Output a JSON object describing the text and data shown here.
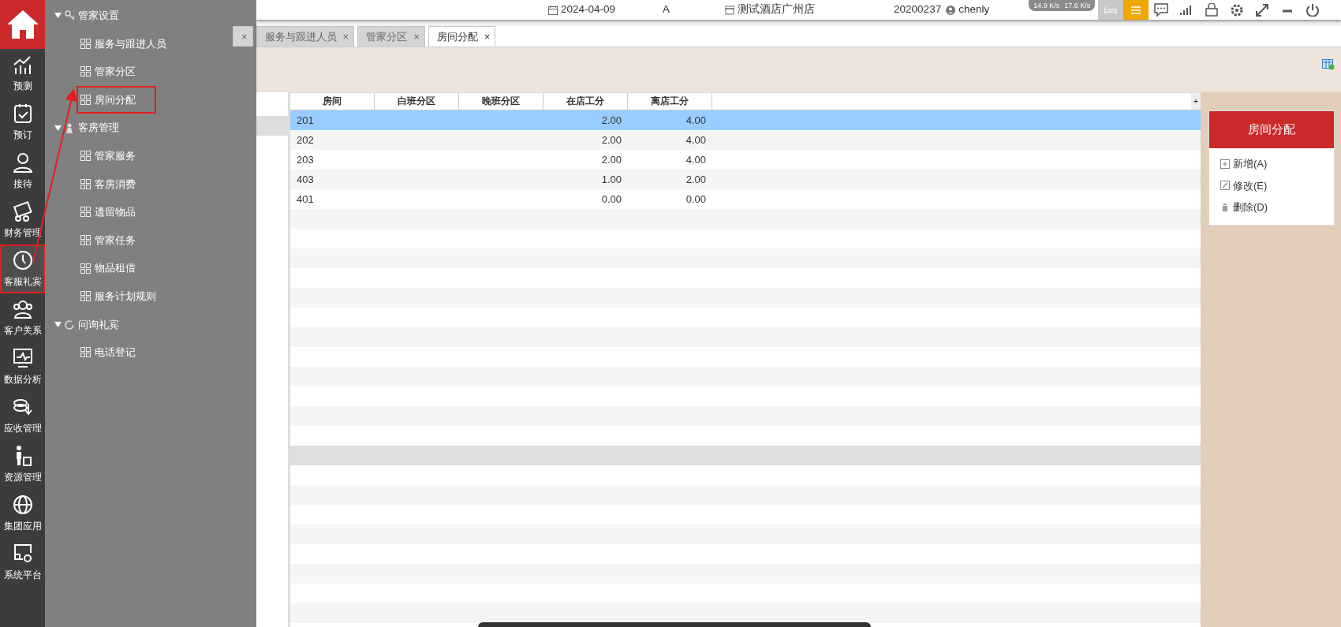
{
  "rail": {
    "items": [
      {
        "label": "预测",
        "selected": false,
        "highlighted": false
      },
      {
        "label": "预订",
        "selected": false,
        "highlighted": false
      },
      {
        "label": "接待",
        "selected": false,
        "highlighted": false
      },
      {
        "label": "财务管理",
        "selected": false,
        "highlighted": false
      },
      {
        "label": "客服礼宾",
        "selected": true,
        "highlighted": true
      },
      {
        "label": "客户关系",
        "selected": false,
        "highlighted": false
      },
      {
        "label": "数据分析",
        "selected": false,
        "highlighted": false
      },
      {
        "label": "应收管理",
        "selected": false,
        "highlighted": false
      },
      {
        "label": "资源管理",
        "selected": false,
        "highlighted": false
      },
      {
        "label": "集团应用",
        "selected": false,
        "highlighted": false
      },
      {
        "label": "系统平台",
        "selected": false,
        "highlighted": false
      }
    ]
  },
  "tree": {
    "groups": [
      {
        "label": "管家设置",
        "expanded": true,
        "children": [
          {
            "label": "服务与跟进人员",
            "highlighted": false
          },
          {
            "label": "管家分区",
            "highlighted": false
          },
          {
            "label": "房间分配",
            "highlighted": true
          }
        ]
      },
      {
        "label": "客房管理",
        "expanded": true,
        "children": [
          {
            "label": "管家服务",
            "highlighted": false
          },
          {
            "label": "客房消费",
            "highlighted": false
          },
          {
            "label": "遗留物品",
            "highlighted": false
          },
          {
            "label": "管家任务",
            "highlighted": false
          },
          {
            "label": "物品租借",
            "highlighted": false
          },
          {
            "label": "服务计划规则",
            "highlighted": false
          }
        ]
      },
      {
        "label": "问询礼宾",
        "expanded": true,
        "children": [
          {
            "label": "电话登记",
            "highlighted": false
          }
        ]
      }
    ]
  },
  "annotation_arrow": true,
  "top_bar": {
    "date": "2024-04-09",
    "shift": "A",
    "hotel": "测试酒店广州店",
    "user_id": "20200237",
    "user": "chenly",
    "net_up": "14.9 K/s",
    "net_down": "17.6 K/s"
  },
  "tabs": [
    {
      "close": "×",
      "selected": false
    },
    {
      "label": "服务与跟进人员",
      "close": "×",
      "selected": false
    },
    {
      "label": "管家分区",
      "close": "×",
      "selected": false
    },
    {
      "label": "房间分配",
      "close": "×",
      "selected": true
    }
  ],
  "table": {
    "columns": [
      "房间",
      "白班分区",
      "晚班分区",
      "在店工分",
      "离店工分"
    ],
    "column_menu": "+",
    "rows": [
      {
        "room": "201",
        "in_house": "2.00",
        "departure": "4.00",
        "selected": true
      },
      {
        "room": "202",
        "in_house": "2.00",
        "departure": "4.00",
        "selected": false
      },
      {
        "room": "203",
        "in_house": "2.00",
        "departure": "4.00",
        "selected": false
      },
      {
        "room": "403",
        "in_house": "1.00",
        "departure": "2.00",
        "selected": false
      },
      {
        "room": "401",
        "in_house": "0.00",
        "departure": "0.00",
        "selected": false
      }
    ]
  },
  "side_panel": {
    "title": "房间分配",
    "actions": [
      {
        "label": "新增(A)",
        "kind": "add"
      },
      {
        "label": "修改(E)",
        "kind": "edit"
      },
      {
        "label": "删除(D)",
        "kind": "delete"
      }
    ]
  }
}
